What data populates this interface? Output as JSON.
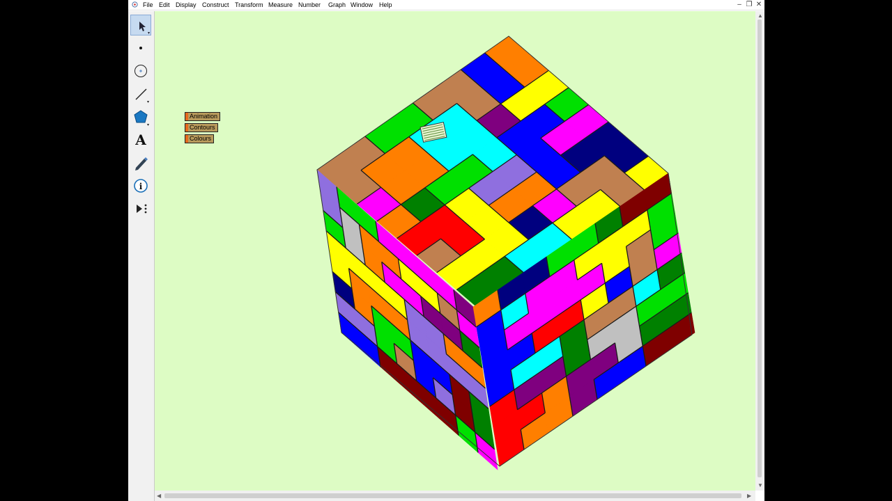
{
  "menubar": {
    "items": [
      "File",
      "Edit",
      "Display",
      "Construct",
      "Transform",
      "Measure",
      "Number",
      "Graph",
      "Window",
      "Help"
    ]
  },
  "window_controls": {
    "minimize": "–",
    "restore": "❐",
    "close": "✕"
  },
  "toolbox": {
    "tools": [
      "selection-arrow-tool",
      "point-tool",
      "compass-tool",
      "straightedge-tool",
      "polygon-tool",
      "text-tool",
      "marker-tool",
      "information-tool",
      "custom-tool"
    ],
    "text_tool_glyph": "A"
  },
  "canvas": {
    "background": "#ddfcc4",
    "buttons": {
      "animation": "Animation",
      "contours": "Contours",
      "colours": "Colours"
    },
    "puzzle_colors": [
      "#ff0000",
      "#00e000",
      "#0000ff",
      "#ffff00",
      "#00ffff",
      "#ff00ff",
      "#ff7f00",
      "#7f007f",
      "#7f0000",
      "#00007f",
      "#008000",
      "#c0c0c0",
      "#8f6fdf",
      "#c08050"
    ]
  }
}
